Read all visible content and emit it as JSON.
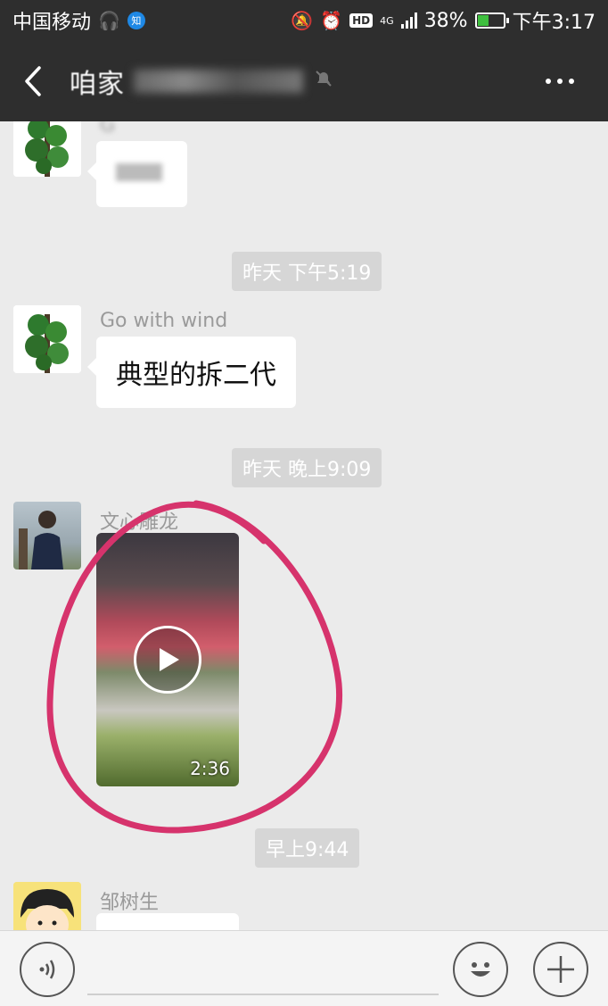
{
  "status_bar": {
    "carrier": "中国移动",
    "zhi_badge": "知",
    "hd_label": "HD",
    "network": "4G",
    "battery": "38%",
    "time": "下午3:17"
  },
  "header": {
    "title_visible": "咱家",
    "icons": [
      "back-icon",
      "mute-icon",
      "more-icon"
    ]
  },
  "messages": [
    {
      "type": "text",
      "sender": "G",
      "text": "",
      "blurred": true
    },
    {
      "type": "timestamp",
      "text": "昨天 下午5:19"
    },
    {
      "type": "text",
      "sender": "Go with wind",
      "text": "典型的拆二代"
    },
    {
      "type": "timestamp",
      "text": "昨天 晚上9:09"
    },
    {
      "type": "video",
      "sender": "文心雕龙",
      "duration": "2:36"
    },
    {
      "type": "timestamp",
      "text": "早上9:44"
    },
    {
      "type": "text",
      "sender": "邹树生",
      "text": "",
      "blurred": true
    }
  ],
  "input_bar": {
    "placeholder": "",
    "icons": [
      "voice-icon",
      "emoji-icon",
      "plus-icon"
    ]
  },
  "colors": {
    "bar_bg": "#2e2e2e",
    "chat_bg": "#ebebeb",
    "annotation": "#d6336c"
  }
}
